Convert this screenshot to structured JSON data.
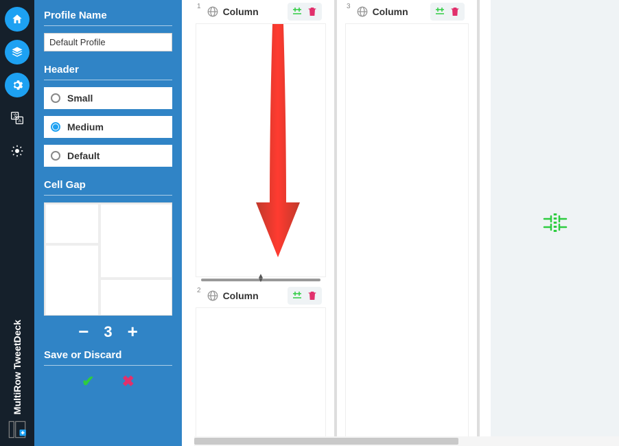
{
  "brand": {
    "line1": "MultiRow",
    "line2": "TweetDeck"
  },
  "panel": {
    "profile_name_label": "Profile Name",
    "profile_name_value": "Default Profile",
    "header_label": "Header",
    "header_options": [
      {
        "label": "Small",
        "selected": false
      },
      {
        "label": "Medium",
        "selected": true
      },
      {
        "label": "Default",
        "selected": false
      }
    ],
    "cell_gap_label": "Cell Gap",
    "cell_gap_value": "3",
    "save_label": "Save or Discard"
  },
  "columns": {
    "c1": {
      "num": "1",
      "label": "Column"
    },
    "c2": {
      "num": "2",
      "label": "Column"
    },
    "c3": {
      "num": "3",
      "label": "Column"
    }
  },
  "icons": {
    "minus": "−",
    "plus": "+",
    "check": "✔",
    "cross": "✖"
  }
}
